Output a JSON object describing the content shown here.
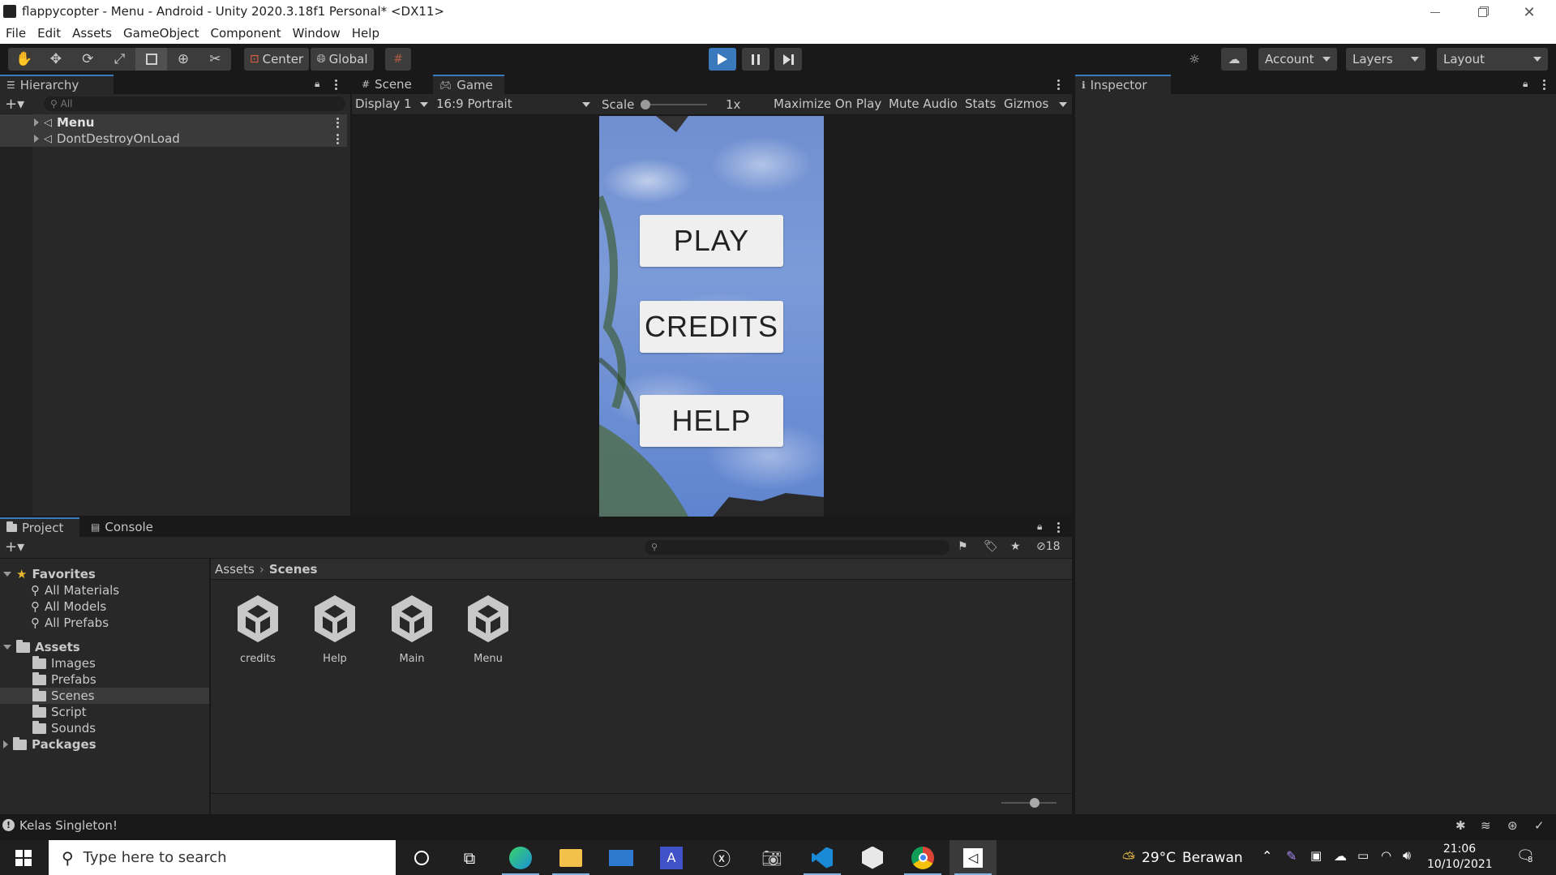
{
  "window": {
    "title": "flappycopter - Menu - Android - Unity 2020.3.18f1 Personal* <DX11>"
  },
  "menu": [
    "File",
    "Edit",
    "Assets",
    "GameObject",
    "Component",
    "Window",
    "Help"
  ],
  "toolbar": {
    "pivot": "Center",
    "space": "Global",
    "account": "Account",
    "layers": "Layers",
    "layout": "Layout"
  },
  "hierarchy": {
    "tab": "Hierarchy",
    "search_placeholder": "All",
    "items": [
      "Menu",
      "DontDestroyOnLoad"
    ]
  },
  "view_tabs": [
    "Scene",
    "Game"
  ],
  "game_bar": {
    "display": "Display 1",
    "aspect": "16:9 Portrait",
    "scale_label": "Scale",
    "scale_value": "1x",
    "maximize": "Maximize On Play",
    "mute": "Mute Audio",
    "stats": "Stats",
    "gizmos": "Gizmos"
  },
  "game_buttons": [
    "PLAY",
    "CREDITS",
    "HELP"
  ],
  "inspector": {
    "tab": "Inspector"
  },
  "project": {
    "tabs": [
      "Project",
      "Console"
    ],
    "hidden_count": "18",
    "favorites_label": "Favorites",
    "favorites": [
      "All Materials",
      "All Models",
      "All Prefabs"
    ],
    "assets_label": "Assets",
    "folders": [
      "Images",
      "Prefabs",
      "Scenes",
      "Script",
      "Sounds"
    ],
    "packages_label": "Packages",
    "breadcrumb": [
      "Assets",
      "Scenes"
    ],
    "files": [
      "credits",
      "Help",
      "Main",
      "Menu"
    ]
  },
  "status": {
    "message": "Kelas Singleton!"
  },
  "taskbar": {
    "search_placeholder": "Type here to search",
    "weather_temp": "29°C",
    "weather_desc": "Berawan",
    "time": "21:06",
    "date": "10/10/2021",
    "notifications": "8"
  },
  "colors": {
    "accent": "#3a79bb",
    "selection": "#2c5d87",
    "panel": "#282828",
    "play_active": "#3a79bb"
  }
}
